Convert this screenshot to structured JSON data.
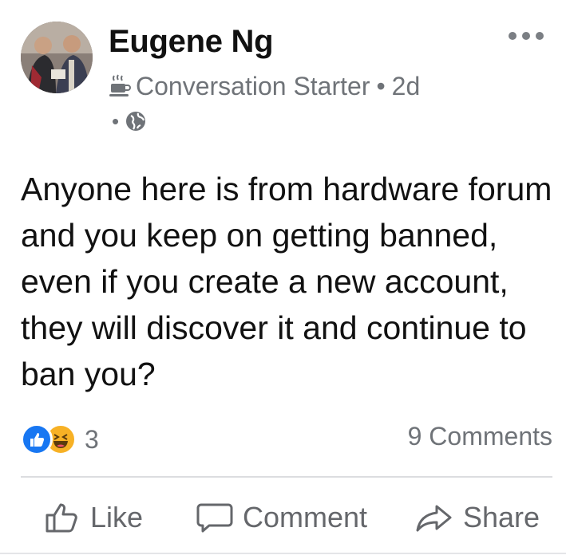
{
  "post": {
    "author": "Eugene Ng",
    "badge_icon": "coffee-cup-icon",
    "badge_label": "Conversation Starter",
    "separator": "•",
    "time": "2d",
    "audience_icon": "globe-icon",
    "text": "Anyone here is from hardware forum and you keep on getting banned, even if you create a new account, they will discover it and continue to ban you?",
    "reaction_icons": [
      "like-reaction-icon",
      "haha-reaction-icon"
    ],
    "reaction_count": "3",
    "comments_count": "9 Comments"
  },
  "actions": {
    "like_label": "Like",
    "comment_label": "Comment",
    "share_label": "Share"
  },
  "colors": {
    "like_blue": "#1877f2",
    "haha_yellow": "#f7b125",
    "secondary_text": "#6f7378"
  }
}
